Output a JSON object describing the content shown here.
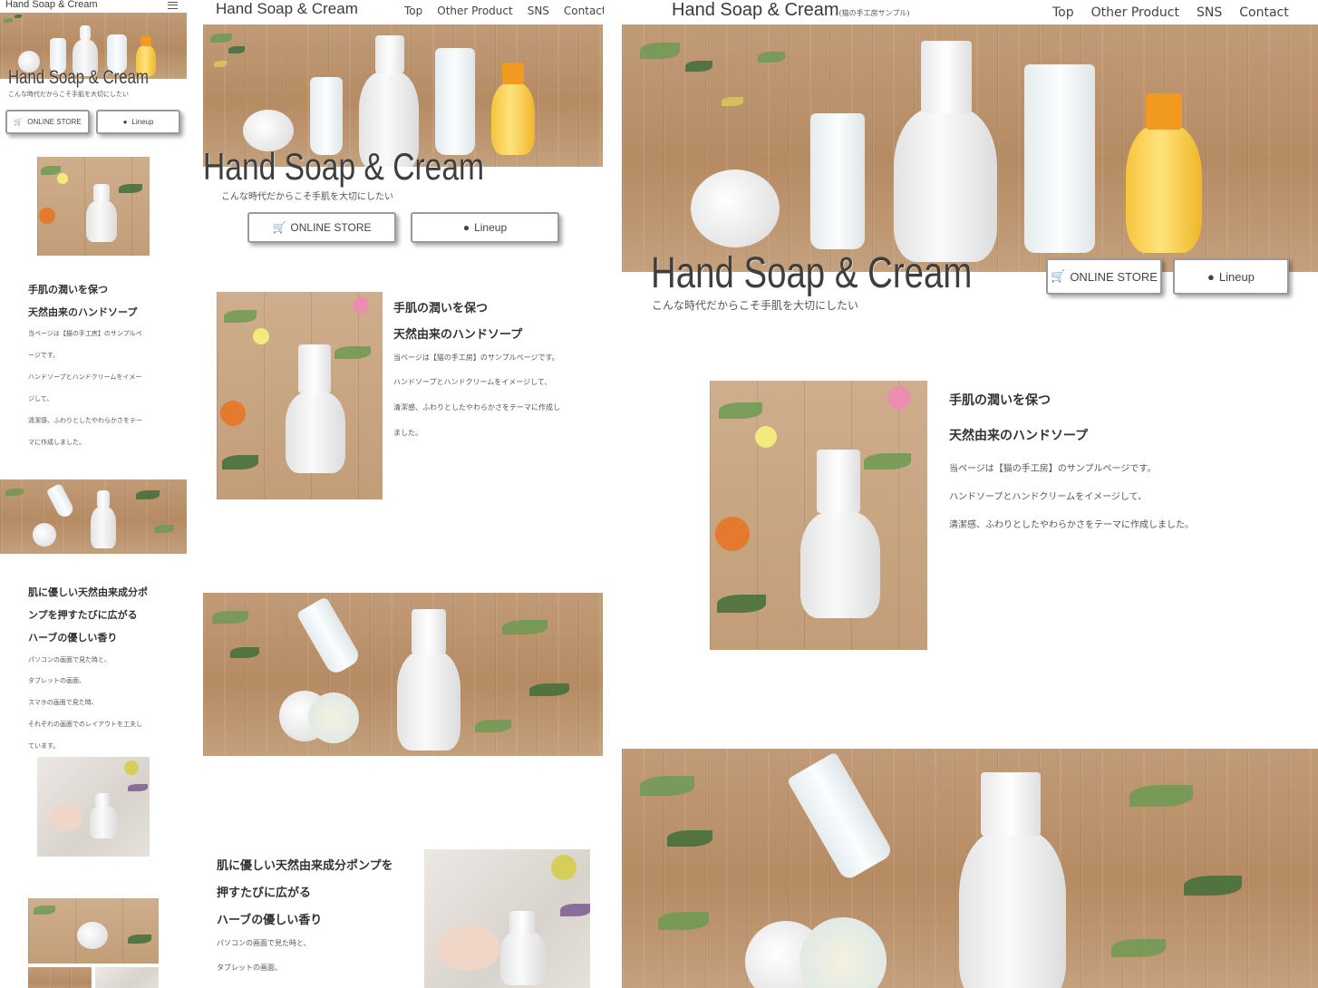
{
  "brand": {
    "name": "Hand Soap & Cream",
    "subtitle": "(猫の手工房サンプル)",
    "tagline": "こんな時代だからこそ手肌を大切にしたい"
  },
  "nav": [
    "Top",
    "Other Product",
    "SNS",
    "Contact"
  ],
  "buttons": {
    "store": "ONLINE STORE",
    "lineup": "Lineup"
  },
  "section1": {
    "heading_lines": [
      "手肌の潤いを保つ",
      "天然由来のハンドソープ"
    ],
    "body_lines": [
      "当ページは【猫の手工房】のサンプルページです。",
      "ハンドソープとハンドクリームをイメージして、",
      "清潔感、ふわりとしたやわらかさをテーマに作成しました。"
    ],
    "mobile_body_lines": [
      "当ページは【猫の手工房】のサンプルペ",
      "ージです。",
      "ハンドソープとハンドクリームをイメー",
      "ジして、",
      "清潔感、ふわりとしたやわらかさをテー",
      "マに作成しました。"
    ],
    "tablet_body_lines": [
      "当ページは【猫の手工房】のサンプルページです。",
      "ハンドソープとハンドクリームをイメージして、",
      "清潔感、ふわりとしたやわらかさをテーマに作成し",
      "ました。"
    ]
  },
  "section2": {
    "mobile_heading_lines": [
      "肌に優しい天然由来成分ポ",
      "ンプを押すたびに広がる",
      "ハーブの優しい香り"
    ],
    "tablet_heading_lines": [
      "肌に優しい天然由来成分ポンプを",
      "押すたびに広がる",
      "ハーブの優しい香り"
    ],
    "mobile_body_lines": [
      "パソコンの画面で見た時と、",
      "タブレットの画面、",
      "スマホの画面で見た時、",
      "それぞれの画面でのレイアウトを工夫し",
      "ています。"
    ],
    "tablet_body_lines": [
      "パソコンの画面で見た時と、",
      "タブレットの画面、"
    ]
  },
  "icons": {
    "cart": "shopping-cart-icon",
    "soap": "soap-bubbles-icon",
    "menu": "hamburger-menu-icon"
  },
  "colors": {
    "text": "#333333",
    "button_border": "#9a9a9a",
    "wood": "#b58b63"
  }
}
